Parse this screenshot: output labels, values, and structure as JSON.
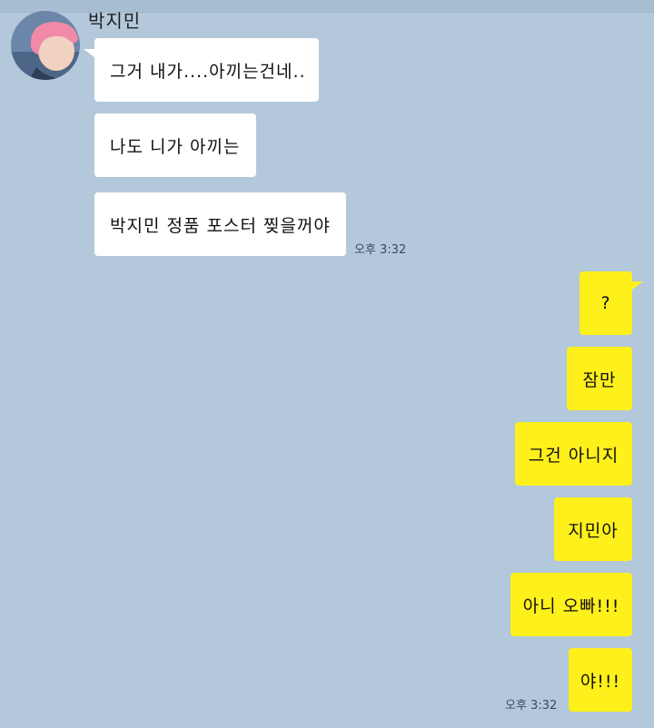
{
  "colors": {
    "background": "#b3c8db",
    "incoming_bubble": "#ffffff",
    "outgoing_bubble": "#fef01b"
  },
  "contact": {
    "name": "박지민",
    "avatar_icon": "profile-photo-pink-hair"
  },
  "incoming": [
    {
      "text": "그거 내가....아끼는건네.."
    },
    {
      "text": "나도 니가 아끼는"
    },
    {
      "text": "박지민 정품 포스터 찢을꺼야"
    }
  ],
  "incoming_time": "오후 3:32",
  "outgoing": [
    {
      "text": "?"
    },
    {
      "text": "잠만"
    },
    {
      "text": "그건 아니지"
    },
    {
      "text": "지민아"
    },
    {
      "text": "아니 오빠!!!"
    },
    {
      "text": "야!!!"
    }
  ],
  "outgoing_time": "오후 3:32"
}
